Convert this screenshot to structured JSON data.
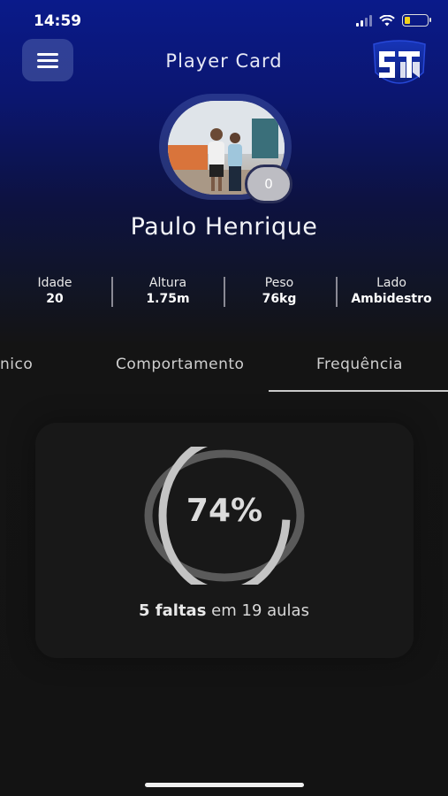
{
  "status_bar": {
    "time": "14:59"
  },
  "header": {
    "title": "Player Card",
    "menu_icon": "hamburger-menu-icon",
    "logo_icon": "team-shield-logo"
  },
  "profile": {
    "name": "Paulo Henrique",
    "badge_number": "0"
  },
  "stats": [
    {
      "label": "Idade",
      "value": "20"
    },
    {
      "label": "Altura",
      "value": "1.75m"
    },
    {
      "label": "Peso",
      "value": "76kg"
    },
    {
      "label": "Lado",
      "value": "Ambidestro"
    }
  ],
  "tabs": [
    {
      "label": "nico"
    },
    {
      "label": "Comportamento"
    },
    {
      "label": "Frequência",
      "active": true
    }
  ],
  "attendance": {
    "percent_label": "74%",
    "percent": 74,
    "absences_label": "5 faltas",
    "classes_label": "em 19 aulas"
  },
  "colors": {
    "ring_track": "#5a5a5a",
    "ring_fill": "#c4c4c4",
    "accent_bg_top": "#0a1a8a",
    "battery": "#f2d21b"
  }
}
